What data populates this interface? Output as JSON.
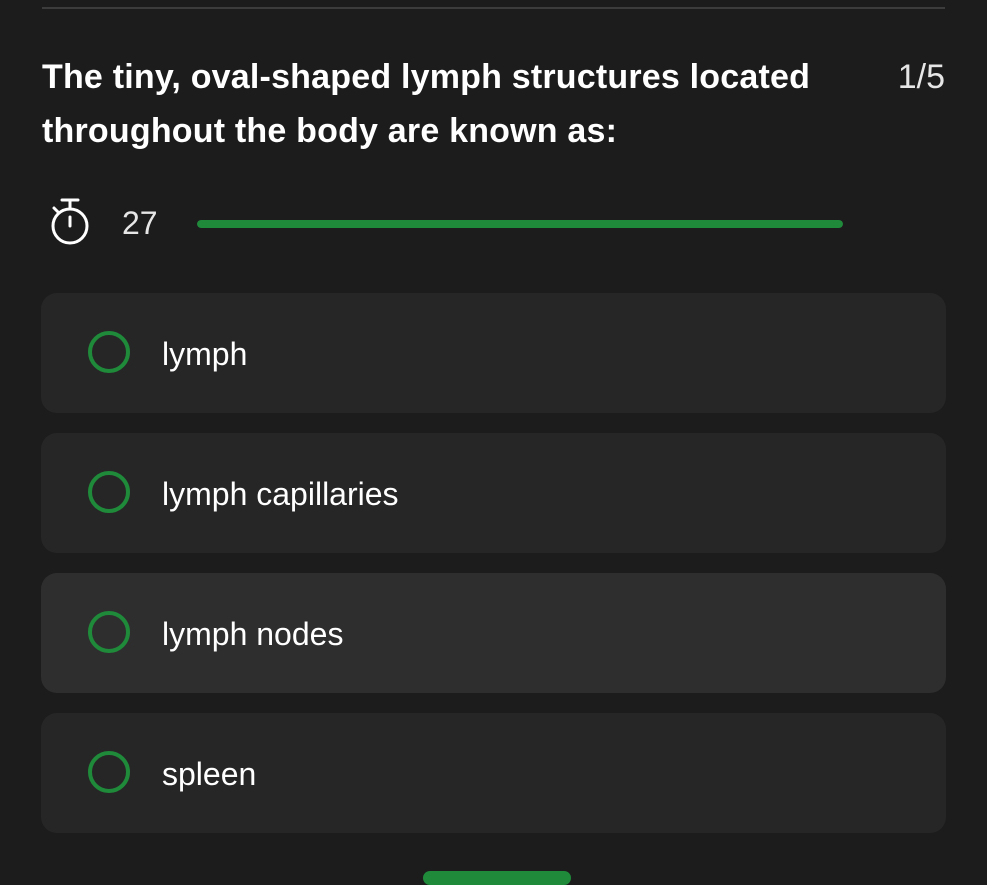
{
  "question": {
    "text": "The tiny, oval-shaped lymph structures located throughout the body are known as:",
    "counter": "1/5"
  },
  "timer": {
    "icon": "stopwatch-icon",
    "seconds_remaining": "27",
    "progress_fraction": 1.0,
    "bar_color": "#1f8b3a"
  },
  "options": [
    {
      "label": "lymph"
    },
    {
      "label": "lymph capillaries"
    },
    {
      "label": "lymph nodes"
    },
    {
      "label": "spleen"
    }
  ],
  "colors": {
    "background": "#1c1c1c",
    "option_background": "#262626",
    "option_highlight": "#2e2e2e",
    "accent": "#1f8b3a"
  }
}
